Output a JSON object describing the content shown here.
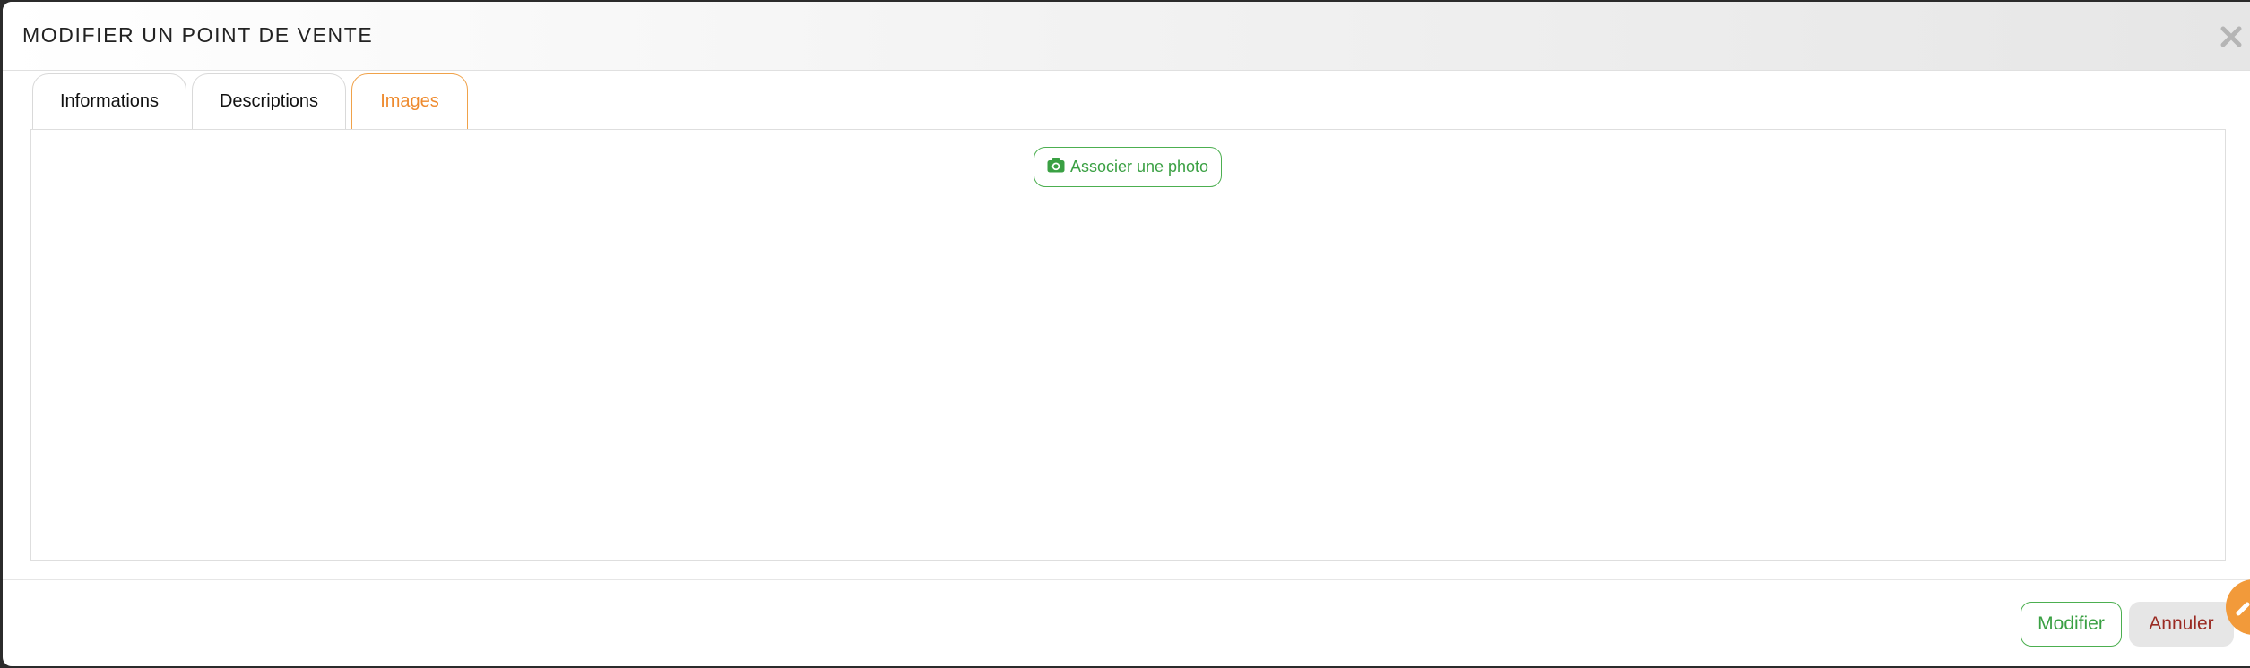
{
  "modal": {
    "title": "MODIFIER UN POINT DE VENTE",
    "close_icon": "close-icon"
  },
  "tabs": [
    {
      "label": "Informations",
      "active": false
    },
    {
      "label": "Descriptions",
      "active": false
    },
    {
      "label": "Images",
      "active": true
    }
  ],
  "images_panel": {
    "add_photo_label": "Associer une photo",
    "add_photo_icon": "camera-icon"
  },
  "footer": {
    "modify_label": "Modifier",
    "cancel_label": "Annuler"
  },
  "floating_button": {
    "icon": "pencil-icon"
  },
  "colors": {
    "accent_orange": "#ee8a2e",
    "success_green": "#3aa043",
    "danger_red": "#9a2a22"
  }
}
